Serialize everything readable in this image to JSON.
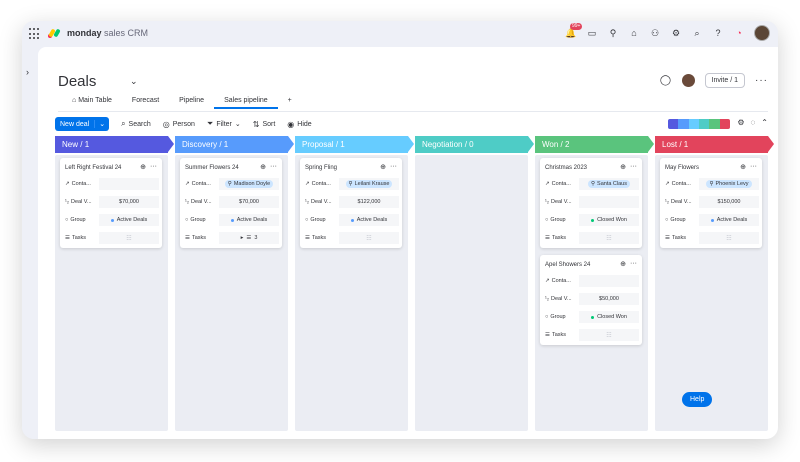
{
  "app": {
    "brand_bold": "monday",
    "brand_rest": " sales CRM",
    "notif_badge": "99+"
  },
  "header": {
    "title": "Deals",
    "invite_label": "Invite / 1",
    "more": "···"
  },
  "tabs": [
    {
      "label": "Main Table"
    },
    {
      "label": "Forecast"
    },
    {
      "label": "Pipeline"
    },
    {
      "label": "Sales pipeline"
    },
    {
      "label": "+"
    }
  ],
  "toolbar": {
    "new_deal": "New deal",
    "search": "Search",
    "person": "Person",
    "filter": "Filter",
    "sort": "Sort",
    "hide": "Hide"
  },
  "columns": [
    {
      "title": "New",
      "count": "/ 1",
      "color": "#5559df"
    },
    {
      "title": "Discovery",
      "count": "/ 1",
      "color": "#579bfc"
    },
    {
      "title": "Proposal",
      "count": "/ 1",
      "color": "#66ccff"
    },
    {
      "title": "Negotiation",
      "count": "/ 0",
      "color": "#4eccc6"
    },
    {
      "title": "Won",
      "count": "/ 2",
      "color": "#5ac47d"
    },
    {
      "title": "Lost",
      "count": "/ 1",
      "color": "#e2445c"
    }
  ],
  "field_labels": {
    "contacts": "Conta...",
    "deal_value": "Deal V...",
    "group": "Group",
    "tasks": "Tasks"
  },
  "cards": [
    {
      "title": "Left Right Festival 24",
      "contact": "",
      "value": "$70,000",
      "group": "Active Deals",
      "tasks": ""
    },
    {
      "title": "Summer Flowers 24",
      "contact": "Madison Doyle",
      "value": "$70,000",
      "group": "Active Deals",
      "tasks": "3"
    },
    {
      "title": "Spring Fling",
      "contact": "Leilani Krause",
      "value": "$122,000",
      "group": "Active Deals",
      "tasks": ""
    },
    {
      "title": "Christmas 2023",
      "contact": "Santa Claus",
      "value": "",
      "group": "Closed Won",
      "tasks": ""
    },
    {
      "title": "Apel Showers 24",
      "contact": "",
      "value": "$50,000",
      "group": "Closed Won",
      "tasks": ""
    },
    {
      "title": "May Flowers",
      "contact": "Phoenix Levy",
      "value": "$150,000",
      "group": "Active Deals",
      "tasks": ""
    }
  ],
  "colors": {
    "accent": "#0073ea",
    "active_dot": "#579bfc",
    "won_dot": "#00c875"
  },
  "help": "Help"
}
